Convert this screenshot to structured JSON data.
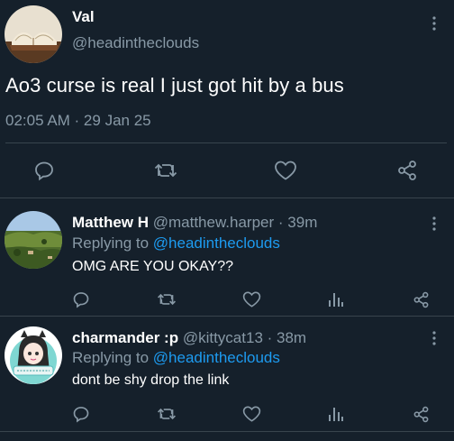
{
  "main_tweet": {
    "name": "Val",
    "handle": "@headintheclouds",
    "text": "Ao3 curse is real I just got hit by a bus",
    "timestamp": "02:05 AM · 29 Jan 25"
  },
  "replies": [
    {
      "name": "Matthew H",
      "handle": "@matthew.harper",
      "age": "· 39m",
      "replying_prefix": "Replying to",
      "replying_handle": "@headintheclouds",
      "text": "OMG ARE YOU OKAY??"
    },
    {
      "name": "charmander :p",
      "handle": "@kittycat13",
      "age": "· 38m",
      "replying_prefix": "Replying to",
      "replying_handle": "@headintheclouds",
      "text": "dont be shy drop the link"
    }
  ],
  "colors": {
    "background": "#15202b",
    "muted": "#8899a6",
    "accent": "#1d9bf0",
    "divider": "#38444d"
  },
  "icons": [
    "more-icon",
    "reply-icon",
    "retweet-icon",
    "like-icon",
    "stats-icon",
    "share-icon"
  ]
}
